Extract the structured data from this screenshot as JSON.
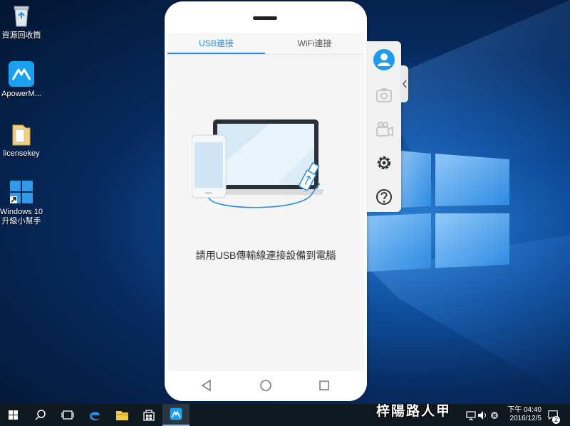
{
  "desktop": {
    "icons": [
      {
        "label": "資源回收筒"
      },
      {
        "label": "ApowerM..."
      },
      {
        "label": "licensekey"
      },
      {
        "label_line1": "Windows 10",
        "label_line2": "升級小幫手"
      }
    ]
  },
  "phone": {
    "tabs": [
      {
        "label": "USB連接",
        "active": true
      },
      {
        "label": "WiFi連接",
        "active": false
      }
    ],
    "instruction": "請用USB傳輸線連接設備到電腦"
  },
  "side_panel": {
    "buttons": [
      "user-icon",
      "screenshot-icon",
      "record-icon",
      "settings-icon",
      "help-icon"
    ]
  },
  "taskbar": {
    "clock_time": "下午 04:40",
    "clock_date": "2016/12/5",
    "notification_count": "2"
  },
  "watermark": "梓陽路人甲",
  "colors": {
    "accent": "#2b8de0",
    "taskbar": "#101820"
  }
}
